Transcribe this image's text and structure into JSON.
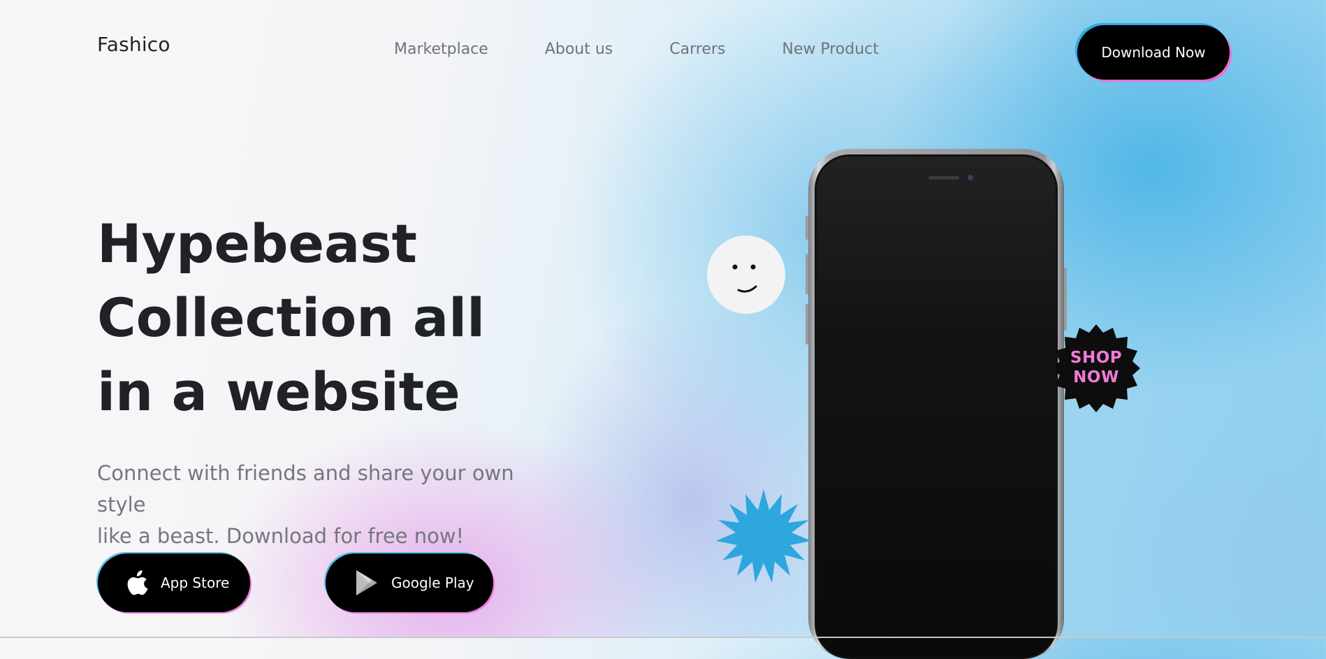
{
  "header": {
    "logo": "Fashico",
    "nav": [
      {
        "label": "Marketplace"
      },
      {
        "label": "About us"
      },
      {
        "label": "Carrers"
      },
      {
        "label": "New Product"
      }
    ],
    "cta_label": "Download Now"
  },
  "hero": {
    "title_lines": [
      "Hypebeast",
      "Collection all",
      "in a website"
    ],
    "subtitle_lines": [
      "Connect with friends and share your own style",
      "like a beast. Download for free now!"
    ],
    "buttons": {
      "app_store": {
        "label": "App Store",
        "icon": "apple-icon"
      },
      "google_play": {
        "label": "Google Play",
        "icon": "google-play-icon"
      }
    }
  },
  "stickers": {
    "shop_badge": {
      "line1": "SHOP",
      "line2": "NOW"
    },
    "smiley": "smiley-face-icon",
    "star": "starburst-icon"
  },
  "colors": {
    "text_dark": "#202226",
    "text_muted": "#74777c",
    "button_bg": "#000000",
    "accent_blue": "#34a9df",
    "accent_pink": "#f07ad8"
  }
}
